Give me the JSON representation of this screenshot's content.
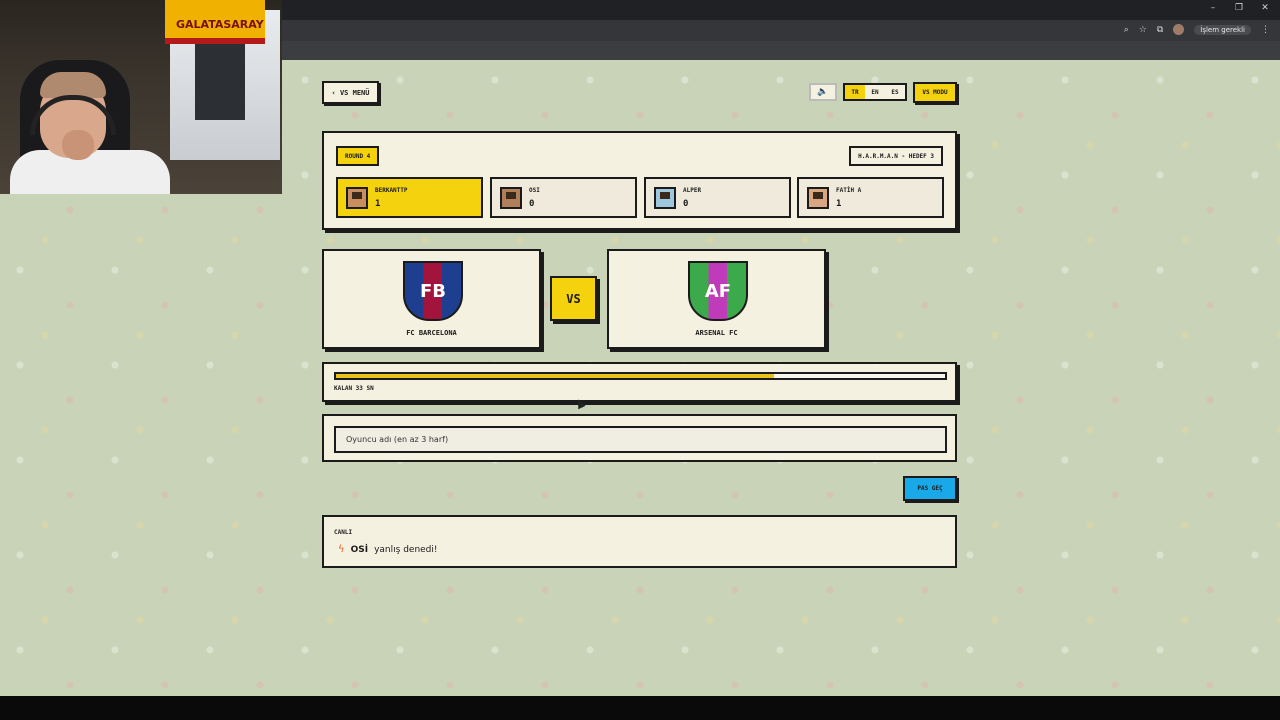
{
  "browser": {
    "profile_label": "İşlem gerekli",
    "window_controls": [
      "–",
      "❐",
      "✕"
    ],
    "toolbar_icons": [
      "zoom-icon",
      "star-icon",
      "extensions-icon"
    ]
  },
  "webcam": {
    "flag_text": "GALATASARAY"
  },
  "header": {
    "back_label": "‹ VS MENÜ",
    "sound_icon": "speaker-icon",
    "languages": [
      "TR",
      "EN",
      "ES"
    ],
    "active_language": "TR",
    "mode_label": "VS MODU"
  },
  "scoreboard": {
    "round_label": "ROUND 4",
    "target_label": "H.A.R.M.A.N - HEDEF 3",
    "players": [
      {
        "name": "BERKANTTP",
        "score": "1",
        "leading": true
      },
      {
        "name": "OSI",
        "score": "0",
        "leading": false
      },
      {
        "name": "ALPER",
        "score": "0",
        "leading": false
      },
      {
        "name": "FATİH A",
        "score": "1",
        "leading": false
      }
    ]
  },
  "match": {
    "home": {
      "initials": "FB",
      "name": "FC BARCELONA"
    },
    "vs_label": "VS",
    "away": {
      "initials": "AF",
      "name": "ARSENAL FC"
    }
  },
  "timer": {
    "label": "KALAN 33 SN",
    "progress_fraction": 0.72,
    "fill_color": "#e9c21a"
  },
  "guess": {
    "placeholder": "Oyuncu adı (en az 3 harf)",
    "value": ""
  },
  "skip_label": "PAS GEÇ",
  "live": {
    "title": "CANLI",
    "event_icon": "bolt-icon",
    "event_name": "OSİ",
    "event_text": "yanlış denedi!"
  },
  "colors": {
    "accent_yellow": "#f5d20e",
    "skip_blue": "#1aa9e8",
    "panel_bg": "#f5f1e1",
    "page_bg": "#c9d3b7"
  }
}
